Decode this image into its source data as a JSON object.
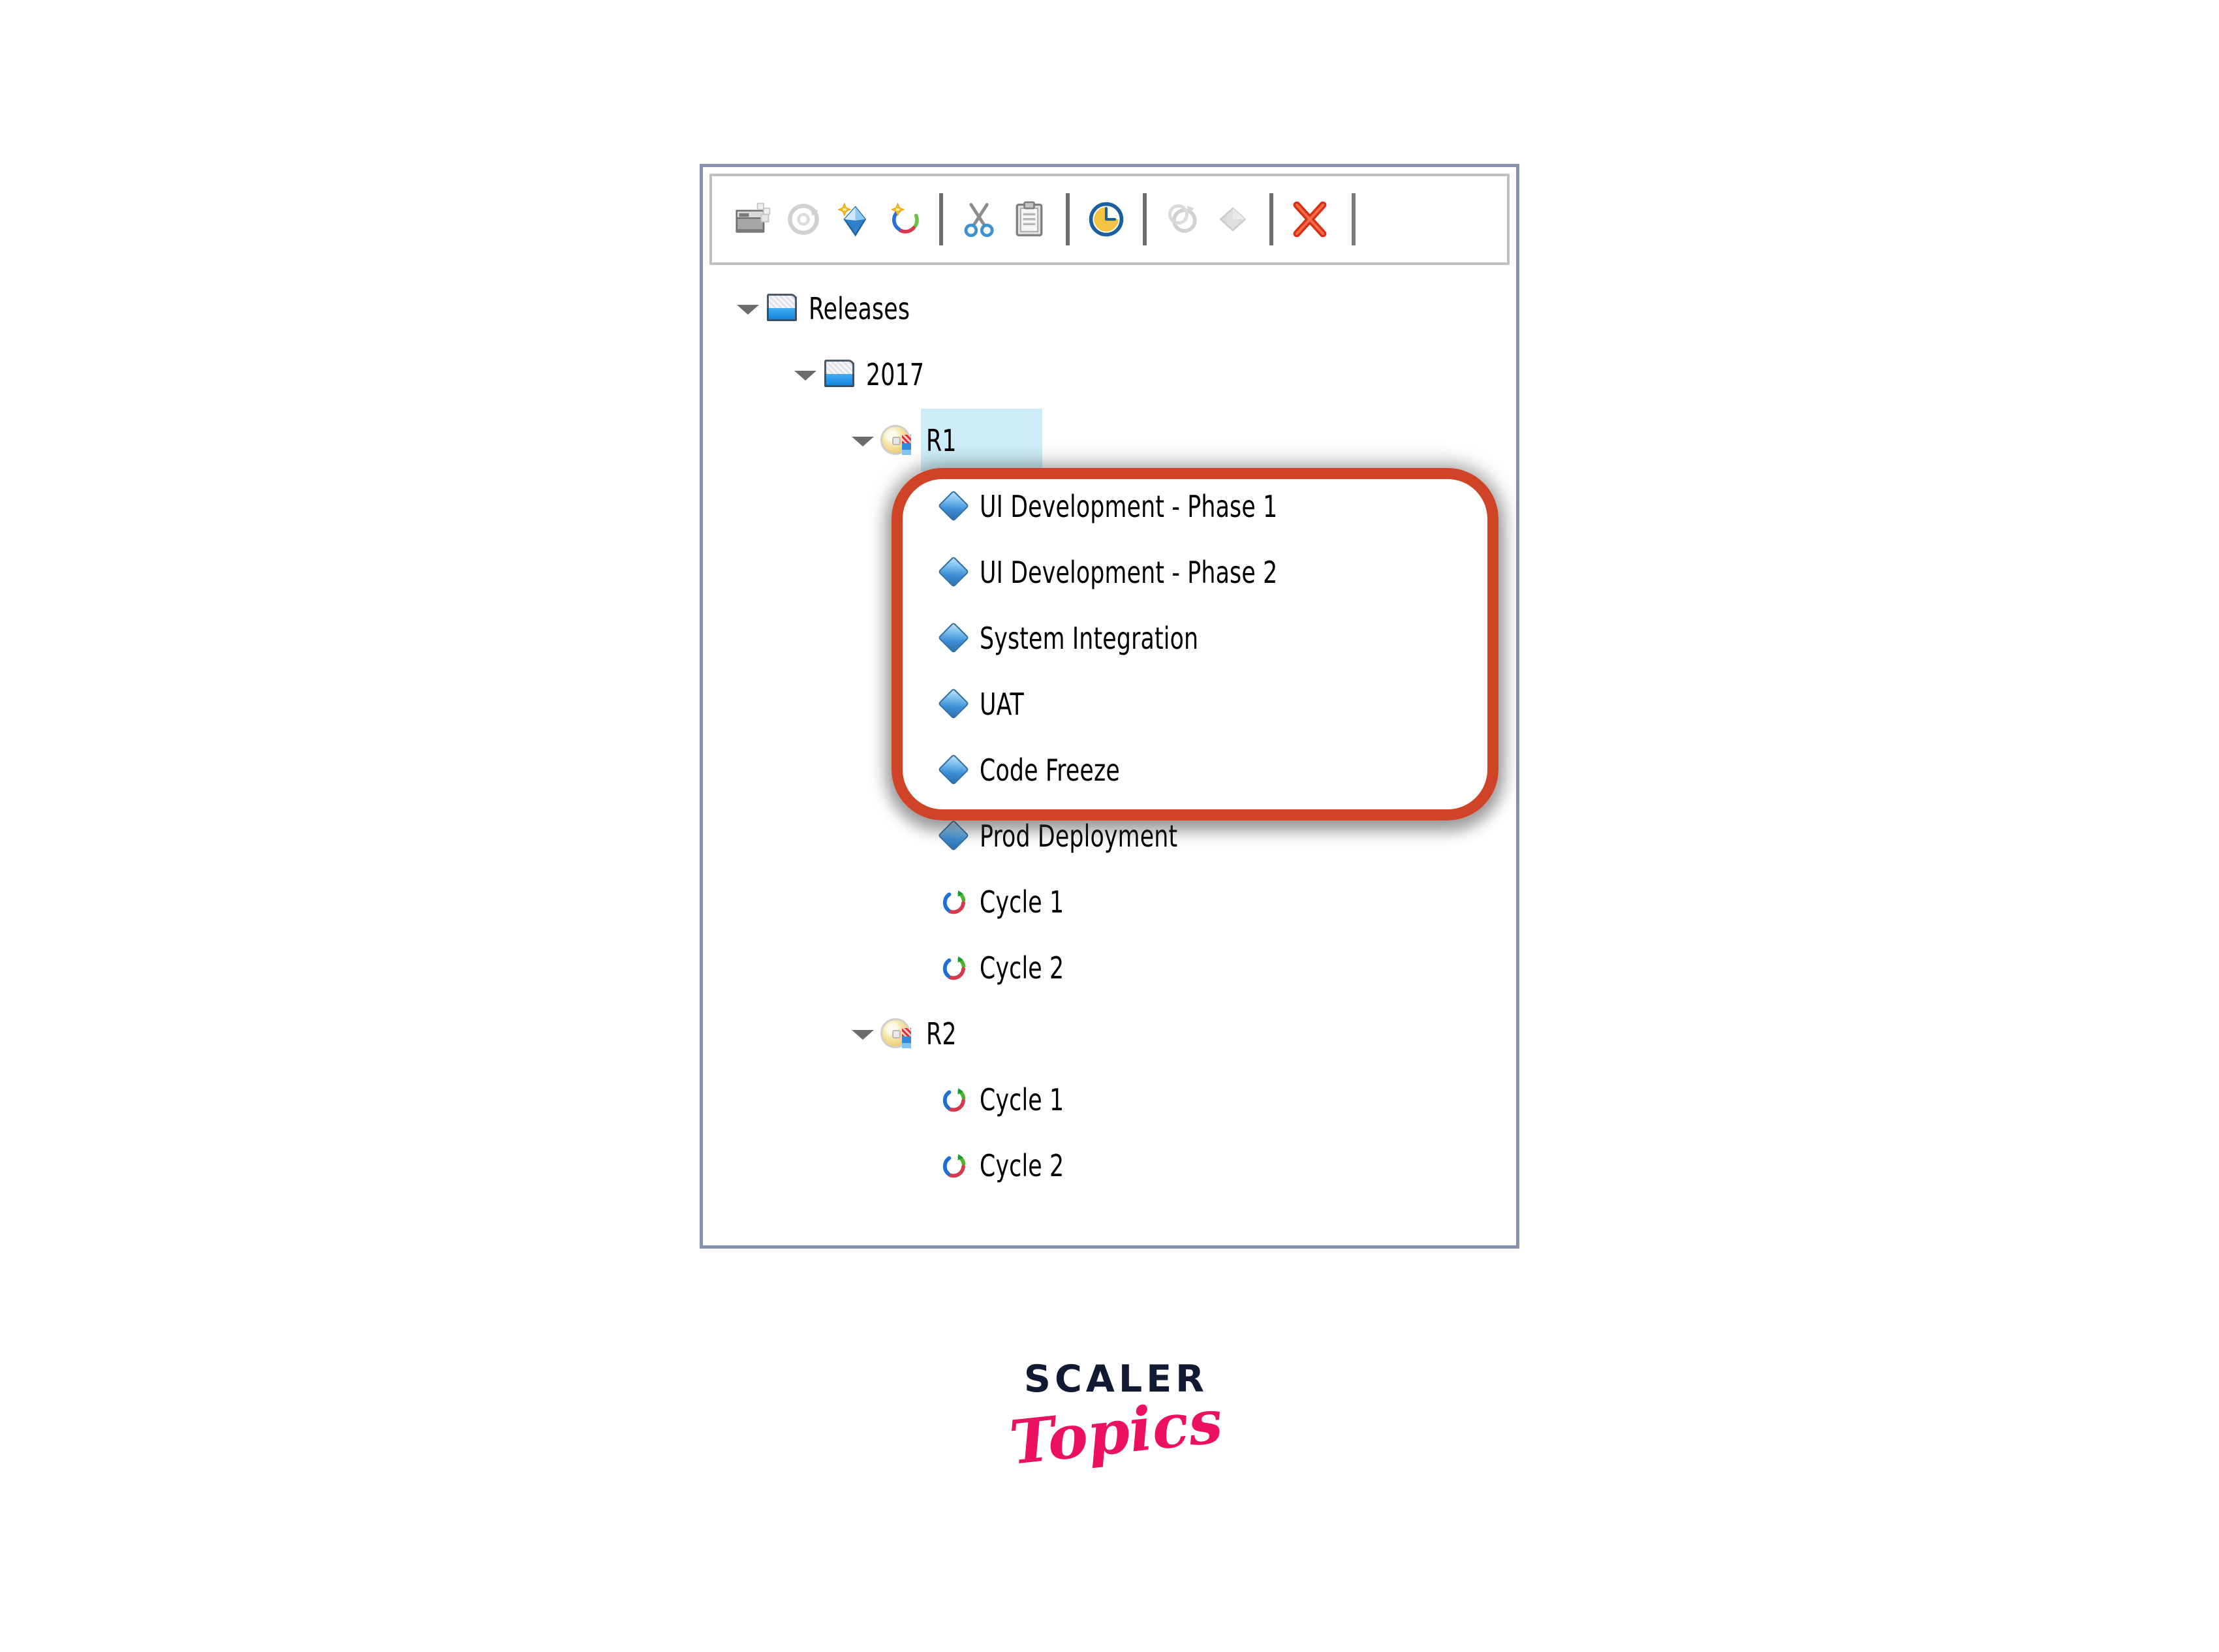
{
  "panel": {
    "name": "releases-tree-panel",
    "border_color": "#8492ad"
  },
  "toolbar": {
    "name": "tree-toolbar",
    "buttons": [
      {
        "id": "new-folder",
        "icon": "new-folder-icon",
        "label": "New Folder",
        "enabled": true
      },
      {
        "id": "refresh",
        "icon": "refresh-icon",
        "label": "Refresh",
        "enabled": false
      },
      {
        "id": "new-release",
        "icon": "new-release-icon",
        "label": "New Release",
        "enabled": true
      },
      {
        "id": "new-cycle",
        "icon": "new-cycle-icon",
        "label": "New Cycle",
        "enabled": true
      },
      {
        "id": "cut",
        "icon": "scissors-icon",
        "label": "Cut",
        "enabled": true
      },
      {
        "id": "paste",
        "icon": "clipboard-icon",
        "label": "Paste",
        "enabled": true
      },
      {
        "id": "history",
        "icon": "clock-icon",
        "label": "History",
        "enabled": true
      },
      {
        "id": "cycle-disabled",
        "icon": "cycle-icon",
        "label": "Cycle",
        "enabled": false
      },
      {
        "id": "milestone-disabled",
        "icon": "diamond-icon",
        "label": "Milestone",
        "enabled": false
      },
      {
        "id": "delete",
        "icon": "red-x-icon",
        "label": "Delete",
        "enabled": true
      }
    ]
  },
  "tree": {
    "name": "releases-tree",
    "selected_node": "R1",
    "selection_color": "#cdeef8",
    "nodes": [
      {
        "label": "Releases",
        "icon": "folder-icon",
        "depth": 0,
        "expanded": true,
        "twisty": true
      },
      {
        "label": "2017",
        "icon": "folder-icon",
        "depth": 1,
        "expanded": true,
        "twisty": true
      },
      {
        "label": "R1",
        "icon": "release-icon",
        "depth": 2,
        "expanded": true,
        "twisty": true,
        "selected": true
      },
      {
        "label": "UI Development - Phase 1",
        "icon": "diamond-icon",
        "depth": 3,
        "twisty": false
      },
      {
        "label": "UI Development - Phase 2",
        "icon": "diamond-icon",
        "depth": 3,
        "twisty": false
      },
      {
        "label": "System Integration",
        "icon": "diamond-icon",
        "depth": 3,
        "twisty": false
      },
      {
        "label": "UAT",
        "icon": "diamond-icon",
        "depth": 3,
        "twisty": false
      },
      {
        "label": "Code Freeze",
        "icon": "diamond-icon",
        "depth": 3,
        "twisty": false
      },
      {
        "label": "Prod Deployment",
        "icon": "diamond-icon",
        "depth": 3,
        "twisty": false
      },
      {
        "label": "Cycle 1",
        "icon": "cycle-icon",
        "depth": 3,
        "twisty": false
      },
      {
        "label": "Cycle 2",
        "icon": "cycle-icon",
        "depth": 3,
        "twisty": false
      },
      {
        "label": "R2",
        "icon": "release-icon",
        "depth": 2,
        "expanded": true,
        "twisty": true
      },
      {
        "label": "Cycle 1",
        "icon": "cycle-icon",
        "depth": 3,
        "twisty": false
      },
      {
        "label": "Cycle 2",
        "icon": "cycle-icon",
        "depth": 3,
        "twisty": false
      }
    ]
  },
  "annotation": {
    "name": "milestones-highlight-box",
    "color": "#cf4326",
    "shape": "rounded-rectangle",
    "encloses": [
      "UI Development - Phase 1",
      "UI Development - Phase 2",
      "System Integration",
      "UAT",
      "Code Freeze",
      "Prod Deployment"
    ]
  },
  "logo": {
    "name": "scaler-topics-logo",
    "primary": "SCALER",
    "secondary": "Topics",
    "primary_color": "#101a33",
    "secondary_color": "#eb1160"
  }
}
